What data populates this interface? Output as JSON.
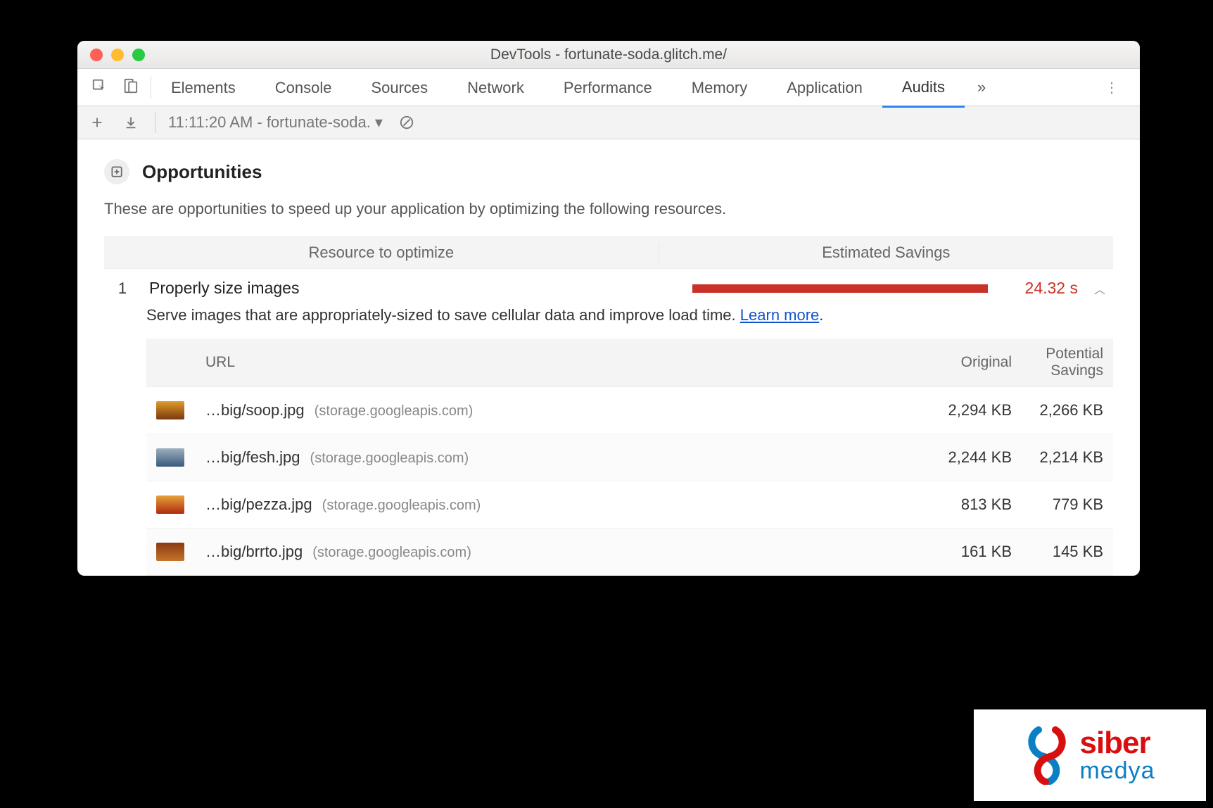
{
  "window": {
    "title": "DevTools - fortunate-soda.glitch.me/"
  },
  "tabs": {
    "items": [
      "Elements",
      "Console",
      "Sources",
      "Network",
      "Performance",
      "Memory",
      "Application",
      "Audits"
    ],
    "active": "Audits",
    "more": "»"
  },
  "subbar": {
    "audit_label": "11:11:20 AM - fortunate-soda."
  },
  "section": {
    "title": "Opportunities",
    "description": "These are opportunities to speed up your application by optimizing the following resources."
  },
  "columns": {
    "resource": "Resource to optimize",
    "savings": "Estimated Savings"
  },
  "audit": {
    "index": "1",
    "title": "Properly size images",
    "savings": "24.32 s",
    "detail": "Serve images that are appropriately-sized to save cellular data and improve load time. ",
    "learn": "Learn more",
    "period": "."
  },
  "table": {
    "head": {
      "url": "URL",
      "original": "Original",
      "potential": "Potential Savings"
    },
    "rows": [
      {
        "path": "…big/soop.jpg",
        "host": "(storage.googleapis.com)",
        "original": "2,294 KB",
        "savings": "2,266 KB"
      },
      {
        "path": "…big/fesh.jpg",
        "host": "(storage.googleapis.com)",
        "original": "2,244 KB",
        "savings": "2,214 KB"
      },
      {
        "path": "…big/pezza.jpg",
        "host": "(storage.googleapis.com)",
        "original": "813 KB",
        "savings": "779 KB"
      },
      {
        "path": "…big/brrto.jpg",
        "host": "(storage.googleapis.com)",
        "original": "161 KB",
        "savings": "145 KB"
      }
    ]
  },
  "watermark": {
    "line1": "siber",
    "line2": "medya"
  }
}
